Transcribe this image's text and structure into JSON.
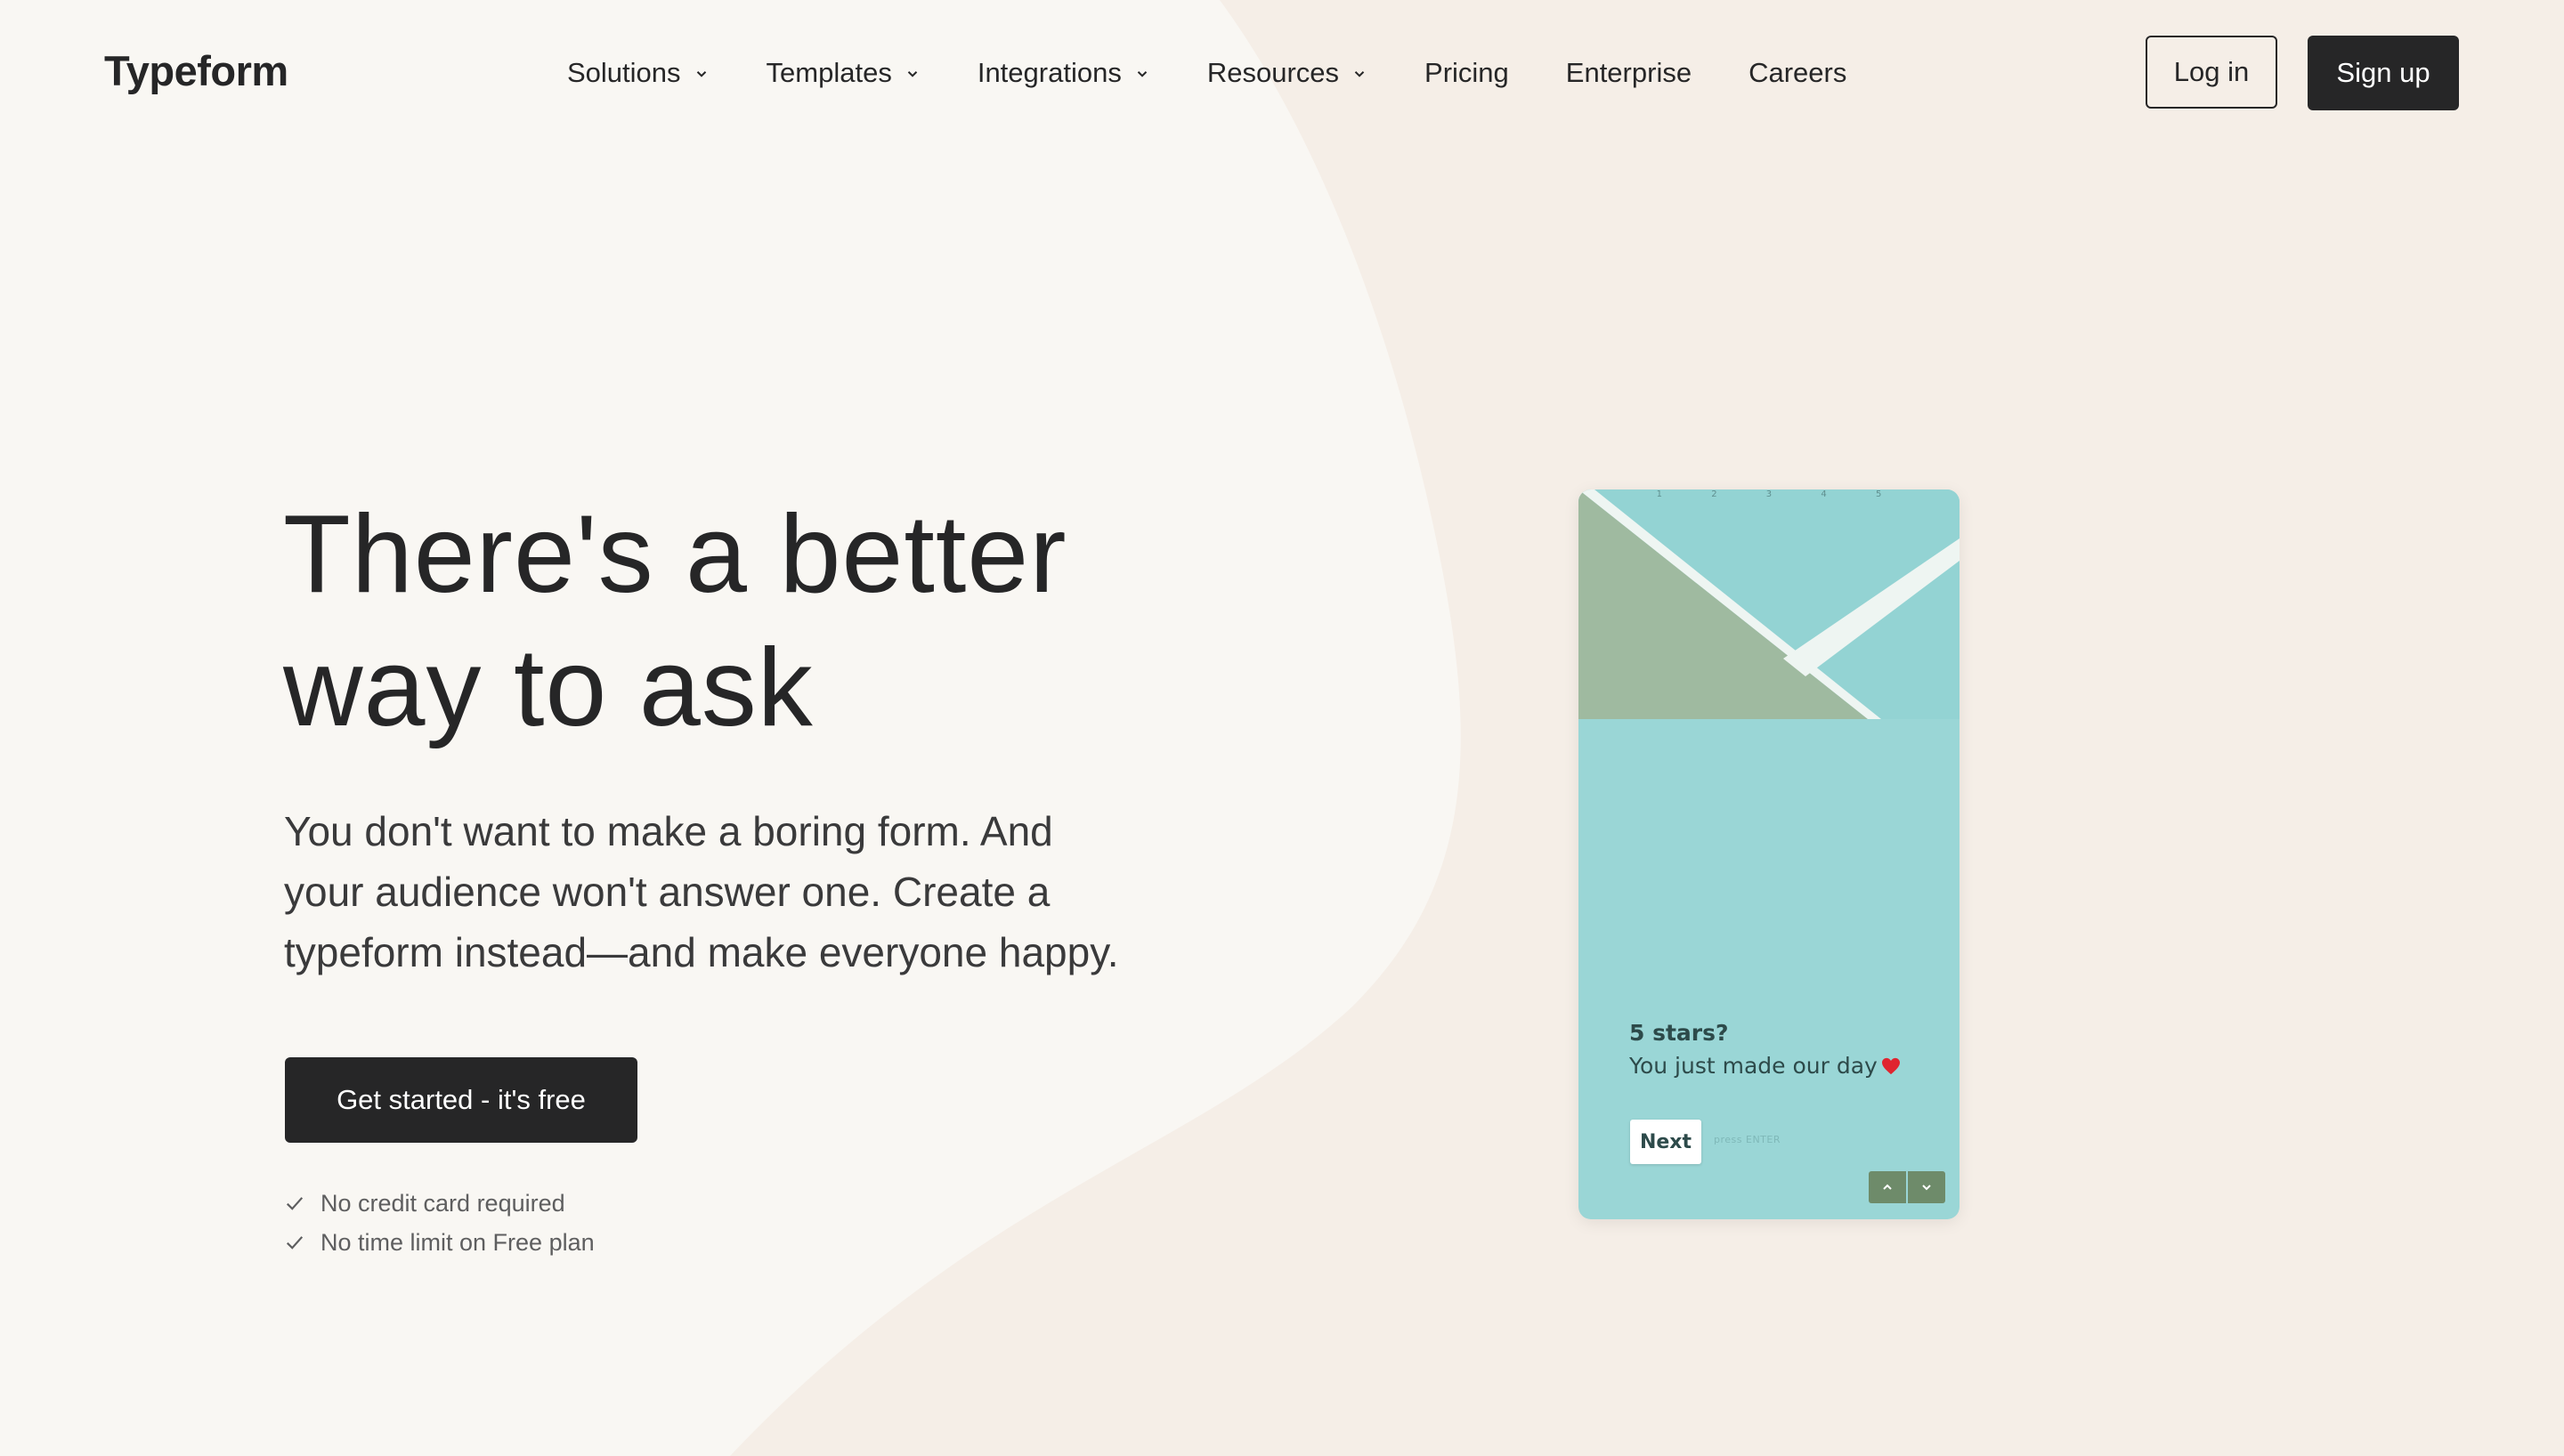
{
  "brand": {
    "logo_text": "Typeform"
  },
  "nav": {
    "items": [
      {
        "label": "Solutions",
        "has_dropdown": true
      },
      {
        "label": "Templates",
        "has_dropdown": true
      },
      {
        "label": "Integrations",
        "has_dropdown": true
      },
      {
        "label": "Resources",
        "has_dropdown": true
      },
      {
        "label": "Pricing",
        "has_dropdown": false
      },
      {
        "label": "Enterprise",
        "has_dropdown": false
      },
      {
        "label": "Careers",
        "has_dropdown": false
      }
    ],
    "login_label": "Log in",
    "signup_label": "Sign up"
  },
  "hero": {
    "title_line1": "There's a better",
    "title_line2": "way to ask",
    "subtitle_line1": "You don't want to make a boring form. And",
    "subtitle_line2": "your audience won't answer one. Create a",
    "subtitle_line3": "typeform instead—and make everyone happy.",
    "cta_label": "Get started - it's free",
    "checks": [
      "No credit card required",
      "No time limit on Free plan"
    ]
  },
  "phone_demo": {
    "progress_labels": [
      "1",
      "2",
      "3",
      "4",
      "5"
    ],
    "question_title": "5 stars?",
    "question_body": "You just made our day",
    "next_label": "Next",
    "hint": "press ENTER"
  },
  "colors": {
    "background": "#f9f7f3",
    "blob": "#f5eee7",
    "text_dark": "#262627",
    "phone_teal": "#9ad6d6",
    "phone_arrow": "#6e8b6a"
  },
  "icons": {
    "nav_dropdown": "chevron-down-icon",
    "check": "check-icon",
    "heart": "heart-icon",
    "arrow_up": "chevron-up-icon",
    "arrow_down": "chevron-down-icon"
  }
}
